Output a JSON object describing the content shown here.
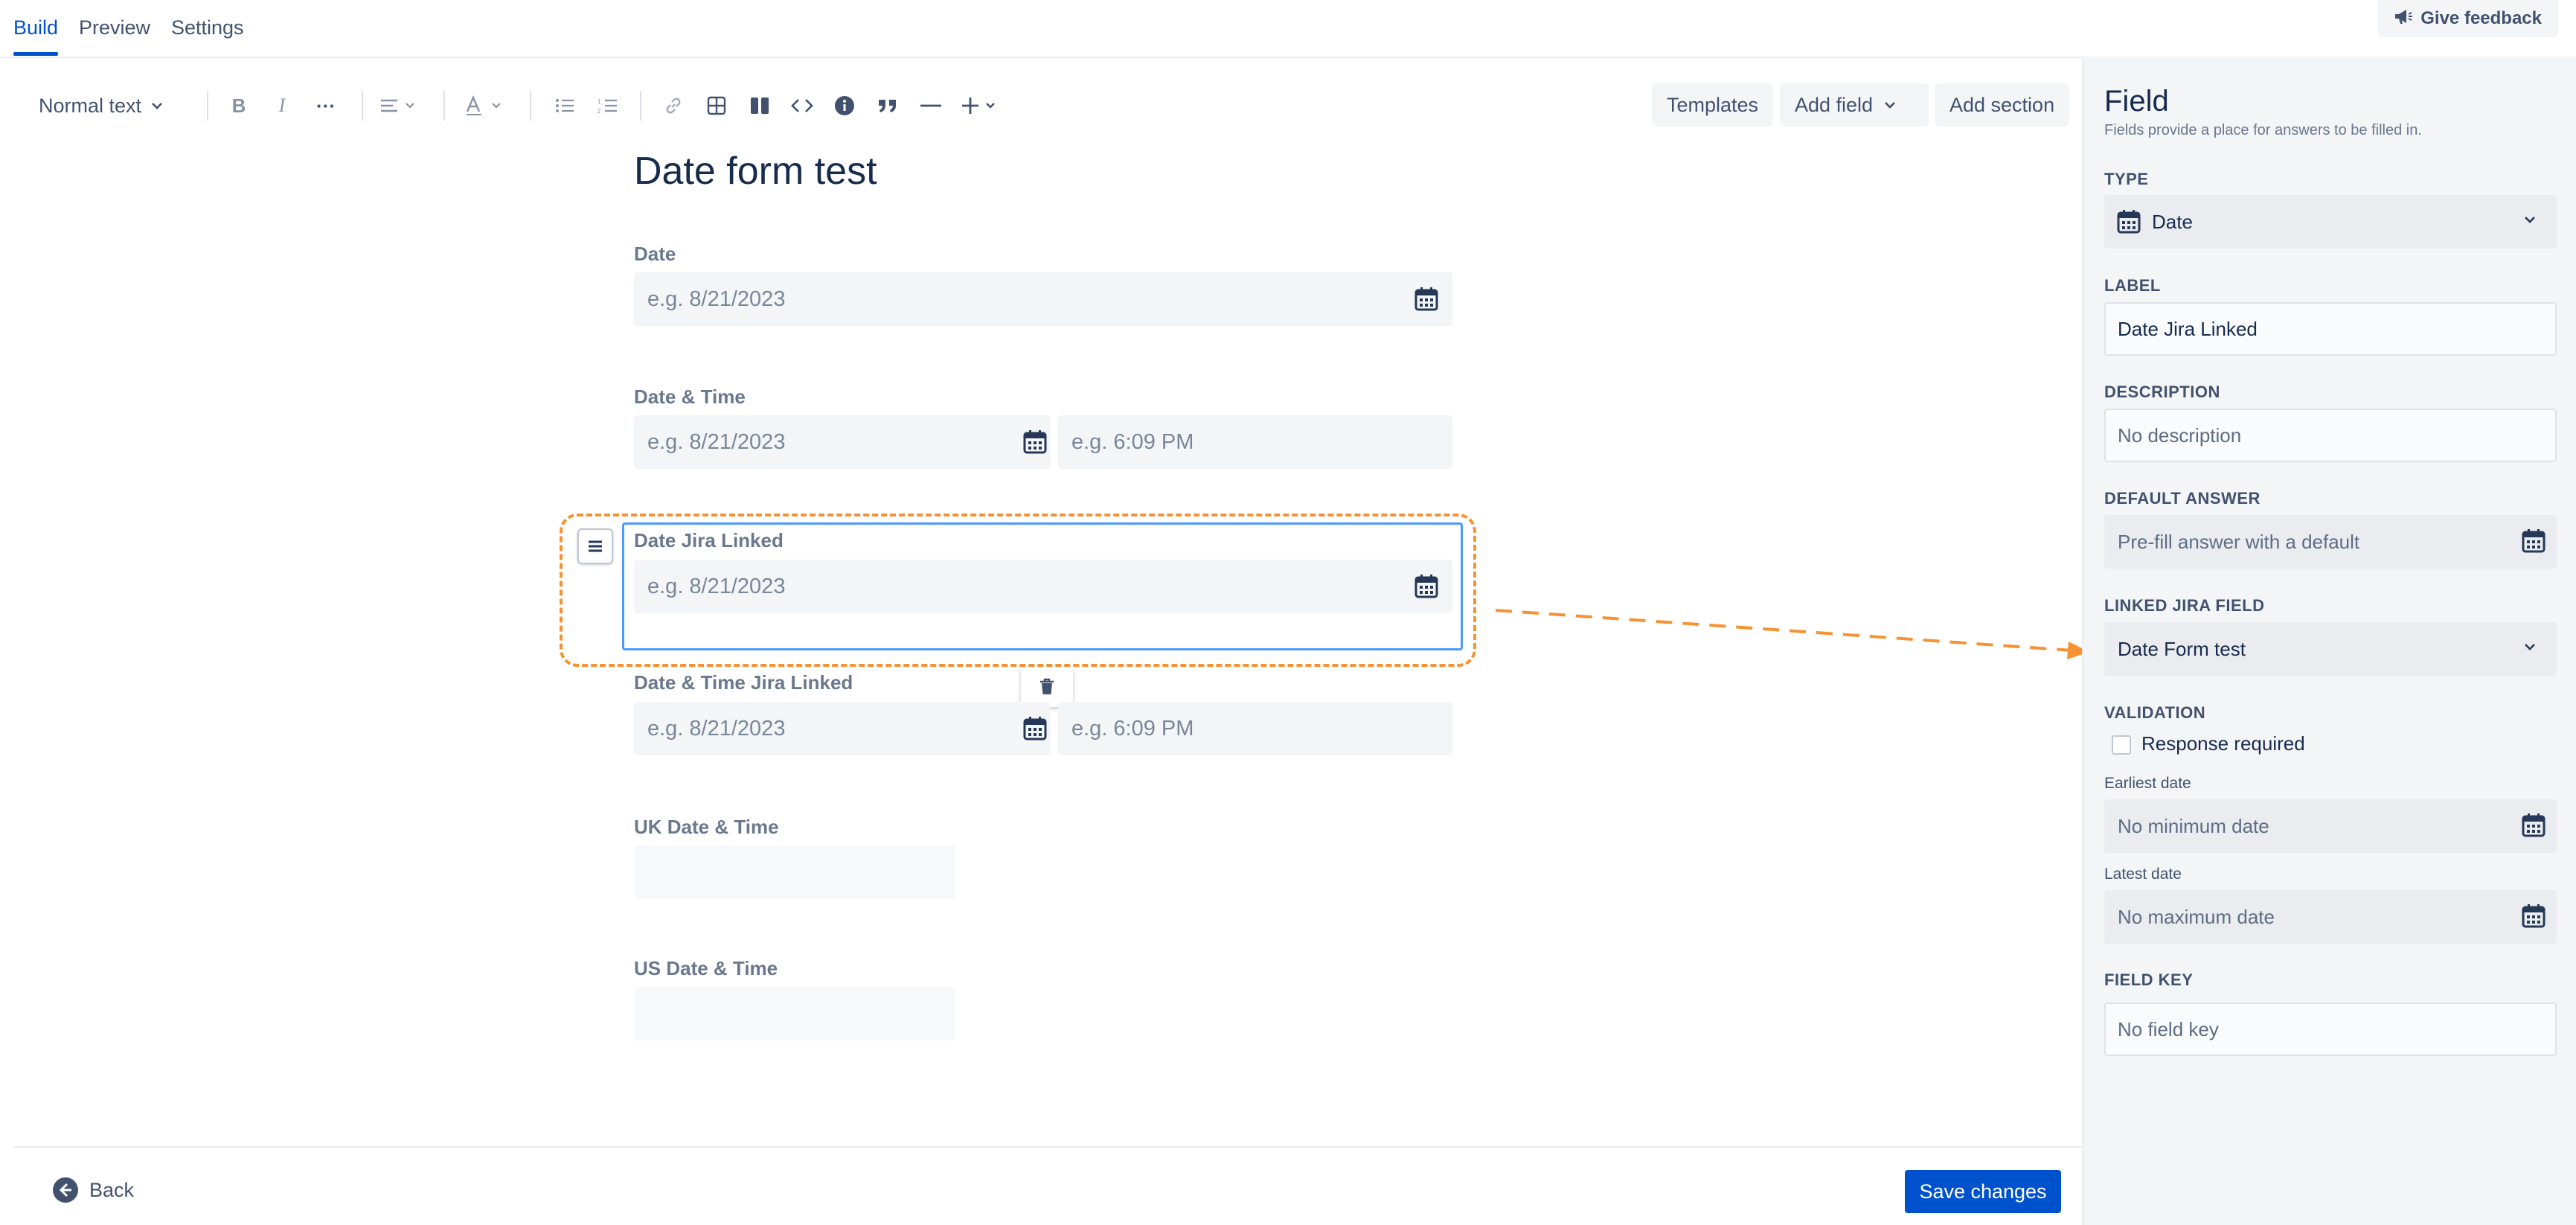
{
  "tabs": [
    "Build",
    "Preview",
    "Settings"
  ],
  "feedback_label": "Give feedback",
  "toolbar": {
    "text_style": "Normal text",
    "templates": "Templates",
    "add_field": "Add field",
    "add_section": "Add section"
  },
  "form": {
    "title": "Date form test",
    "fields": [
      {
        "label": "Date",
        "date_placeholder": "e.g. 8/21/2023"
      },
      {
        "label": "Date & Time",
        "date_placeholder": "e.g. 8/21/2023",
        "time_placeholder": "e.g. 6:09 PM"
      },
      {
        "label": "Date Jira Linked",
        "date_placeholder": "e.g. 8/21/2023"
      },
      {
        "label": "Date & Time Jira Linked",
        "date_placeholder": "e.g. 8/21/2023",
        "time_placeholder": "e.g. 6:09 PM"
      },
      {
        "label": "UK Date & Time"
      },
      {
        "label": "US Date & Time"
      }
    ]
  },
  "panel": {
    "title": "Field",
    "subtitle": "Fields provide a place for answers to be filled in.",
    "type_label": "TYPE",
    "type_value": "Date",
    "label_label": "LABEL",
    "label_value": "Date Jira Linked",
    "description_label": "DESCRIPTION",
    "description_placeholder": "No description",
    "default_label": "DEFAULT ANSWER",
    "default_placeholder": "Pre-fill answer with a default",
    "linked_label": "LINKED JIRA FIELD",
    "linked_value": "Date Form test",
    "validation_label": "VALIDATION",
    "response_required": "Response required",
    "earliest_label": "Earliest date",
    "earliest_placeholder": "No minimum date",
    "latest_label": "Latest date",
    "latest_placeholder": "No maximum date",
    "fieldkey_label": "FIELD KEY",
    "fieldkey_placeholder": "No field key"
  },
  "footer": {
    "back": "Back",
    "save": "Save changes"
  },
  "colors": {
    "accent": "#0052CC",
    "highlight": "#F79232",
    "selection": "#4C9AFF"
  }
}
